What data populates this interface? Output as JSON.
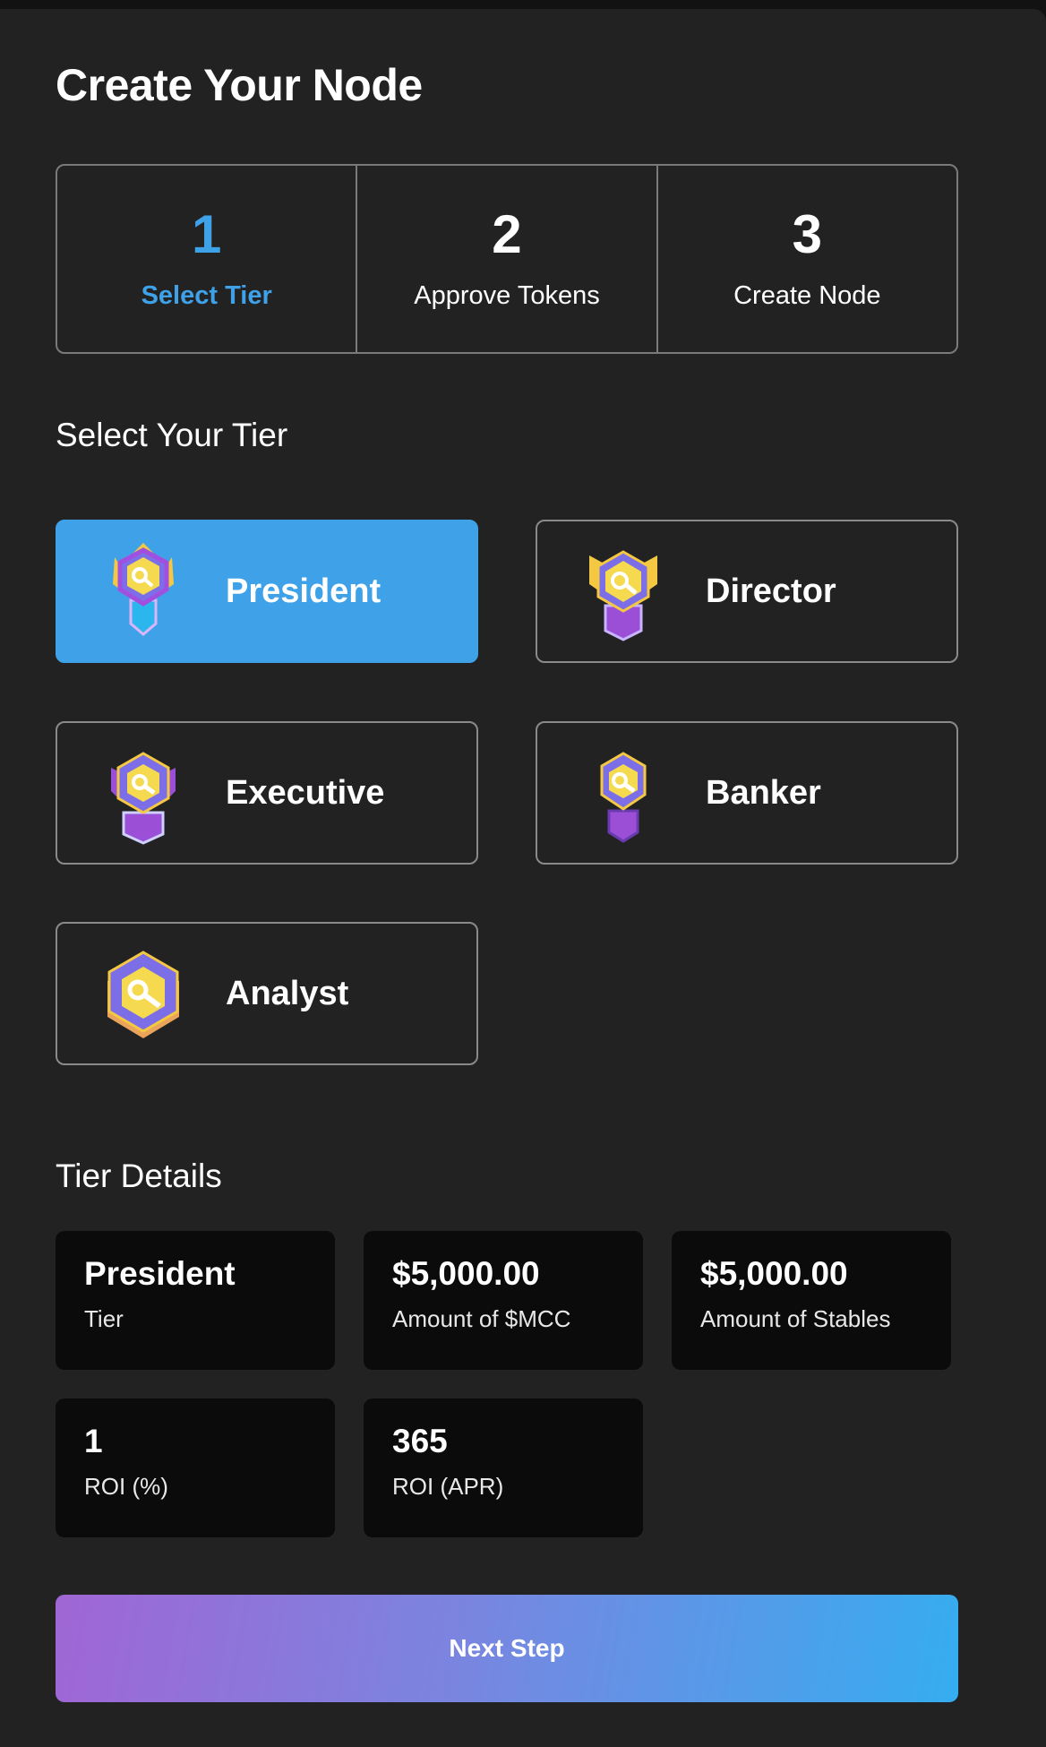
{
  "page": {
    "title": "Create Your Node"
  },
  "steps": [
    {
      "number": "1",
      "label": "Select Tier",
      "active": true
    },
    {
      "number": "2",
      "label": "Approve Tokens",
      "active": false
    },
    {
      "number": "3",
      "label": "Create Node",
      "active": false
    }
  ],
  "select_section": {
    "title": "Select Your Tier"
  },
  "tiers": [
    {
      "name": "President",
      "icon": "president-badge-icon",
      "selected": true
    },
    {
      "name": "Director",
      "icon": "director-badge-icon",
      "selected": false
    },
    {
      "name": "Executive",
      "icon": "executive-badge-icon",
      "selected": false
    },
    {
      "name": "Banker",
      "icon": "banker-badge-icon",
      "selected": false
    },
    {
      "name": "Analyst",
      "icon": "analyst-badge-icon",
      "selected": false
    }
  ],
  "details_section": {
    "title": "Tier Details"
  },
  "details": [
    {
      "value": "President",
      "label": "Tier"
    },
    {
      "value": "$5,000.00",
      "label": "Amount of $MCC"
    },
    {
      "value": "$5,000.00",
      "label": "Amount of Stables"
    },
    {
      "value": "1",
      "label": "ROI (%)"
    },
    {
      "value": "365",
      "label": "ROI (APR)"
    }
  ],
  "actions": {
    "next_label": "Next Step"
  },
  "colors": {
    "background": "#222223",
    "accent": "#3fa2e8",
    "card_dark": "#0b0b0b",
    "gradient_start": "#a066d4",
    "gradient_end": "#35adf0"
  }
}
